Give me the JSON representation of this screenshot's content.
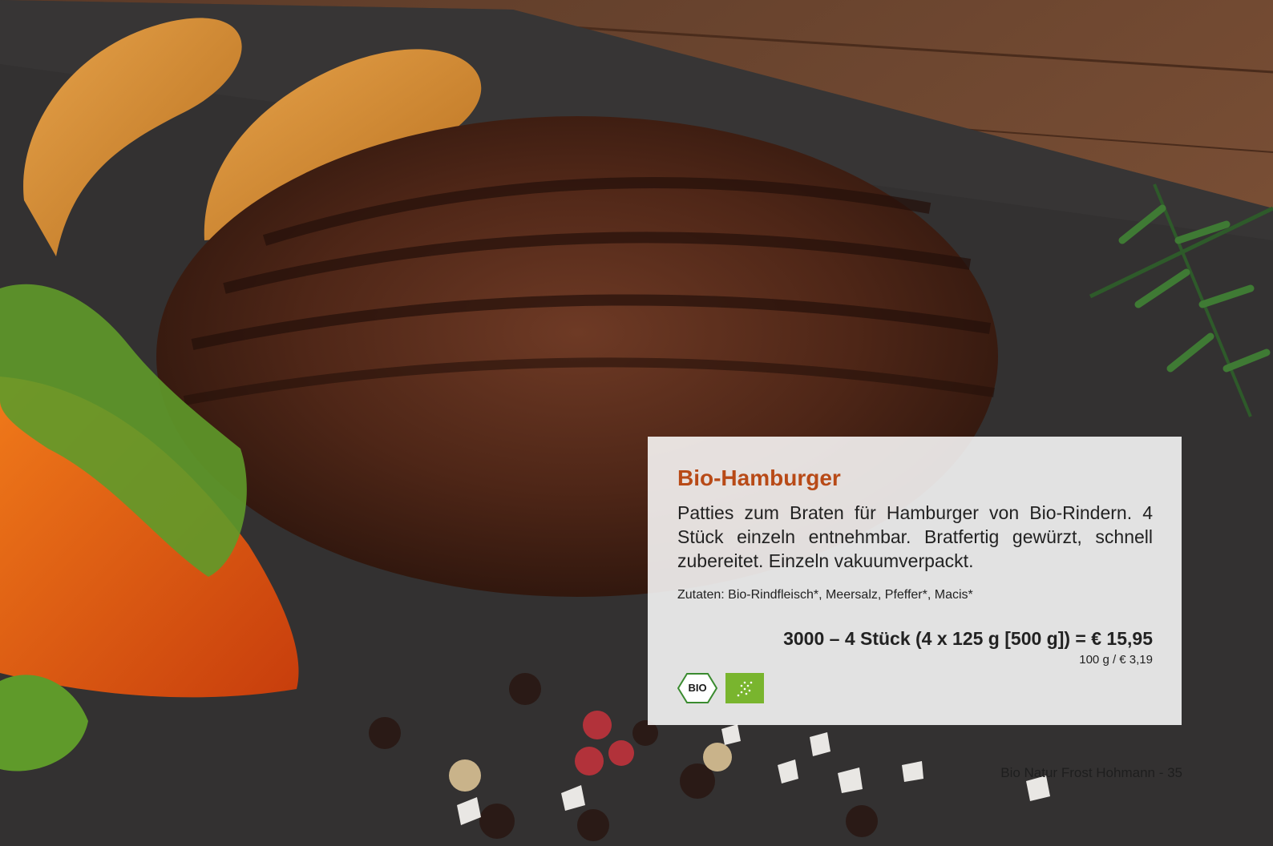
{
  "product": {
    "title": "Bio-Hamburger",
    "description": "Patties zum Braten für Hamburger von Bio-Rindern. 4 Stück einzeln entnehmbar. Bratfertig gewürzt, schnell zubereitet. Einzeln vakuumverpackt.",
    "ingredients": "Zutaten: Bio-Rindfleisch*, Meersalz, Pfeffer*, Macis*",
    "price_line": "3000 – 4 Stück (4 x 125 g [500 g]) = € 15,95",
    "unit_price": "100 g / € 3,19",
    "bio_seal_text": "BIO"
  },
  "footer": {
    "text": "Bio Natur Frost Hohmann - 35"
  },
  "colors": {
    "title": "#b84a17",
    "eu_leaf": "#79b52e",
    "bio_seal_green": "#3a8b2f"
  },
  "icons": [
    "bio-siegel-icon",
    "eu-organic-leaf-icon"
  ]
}
